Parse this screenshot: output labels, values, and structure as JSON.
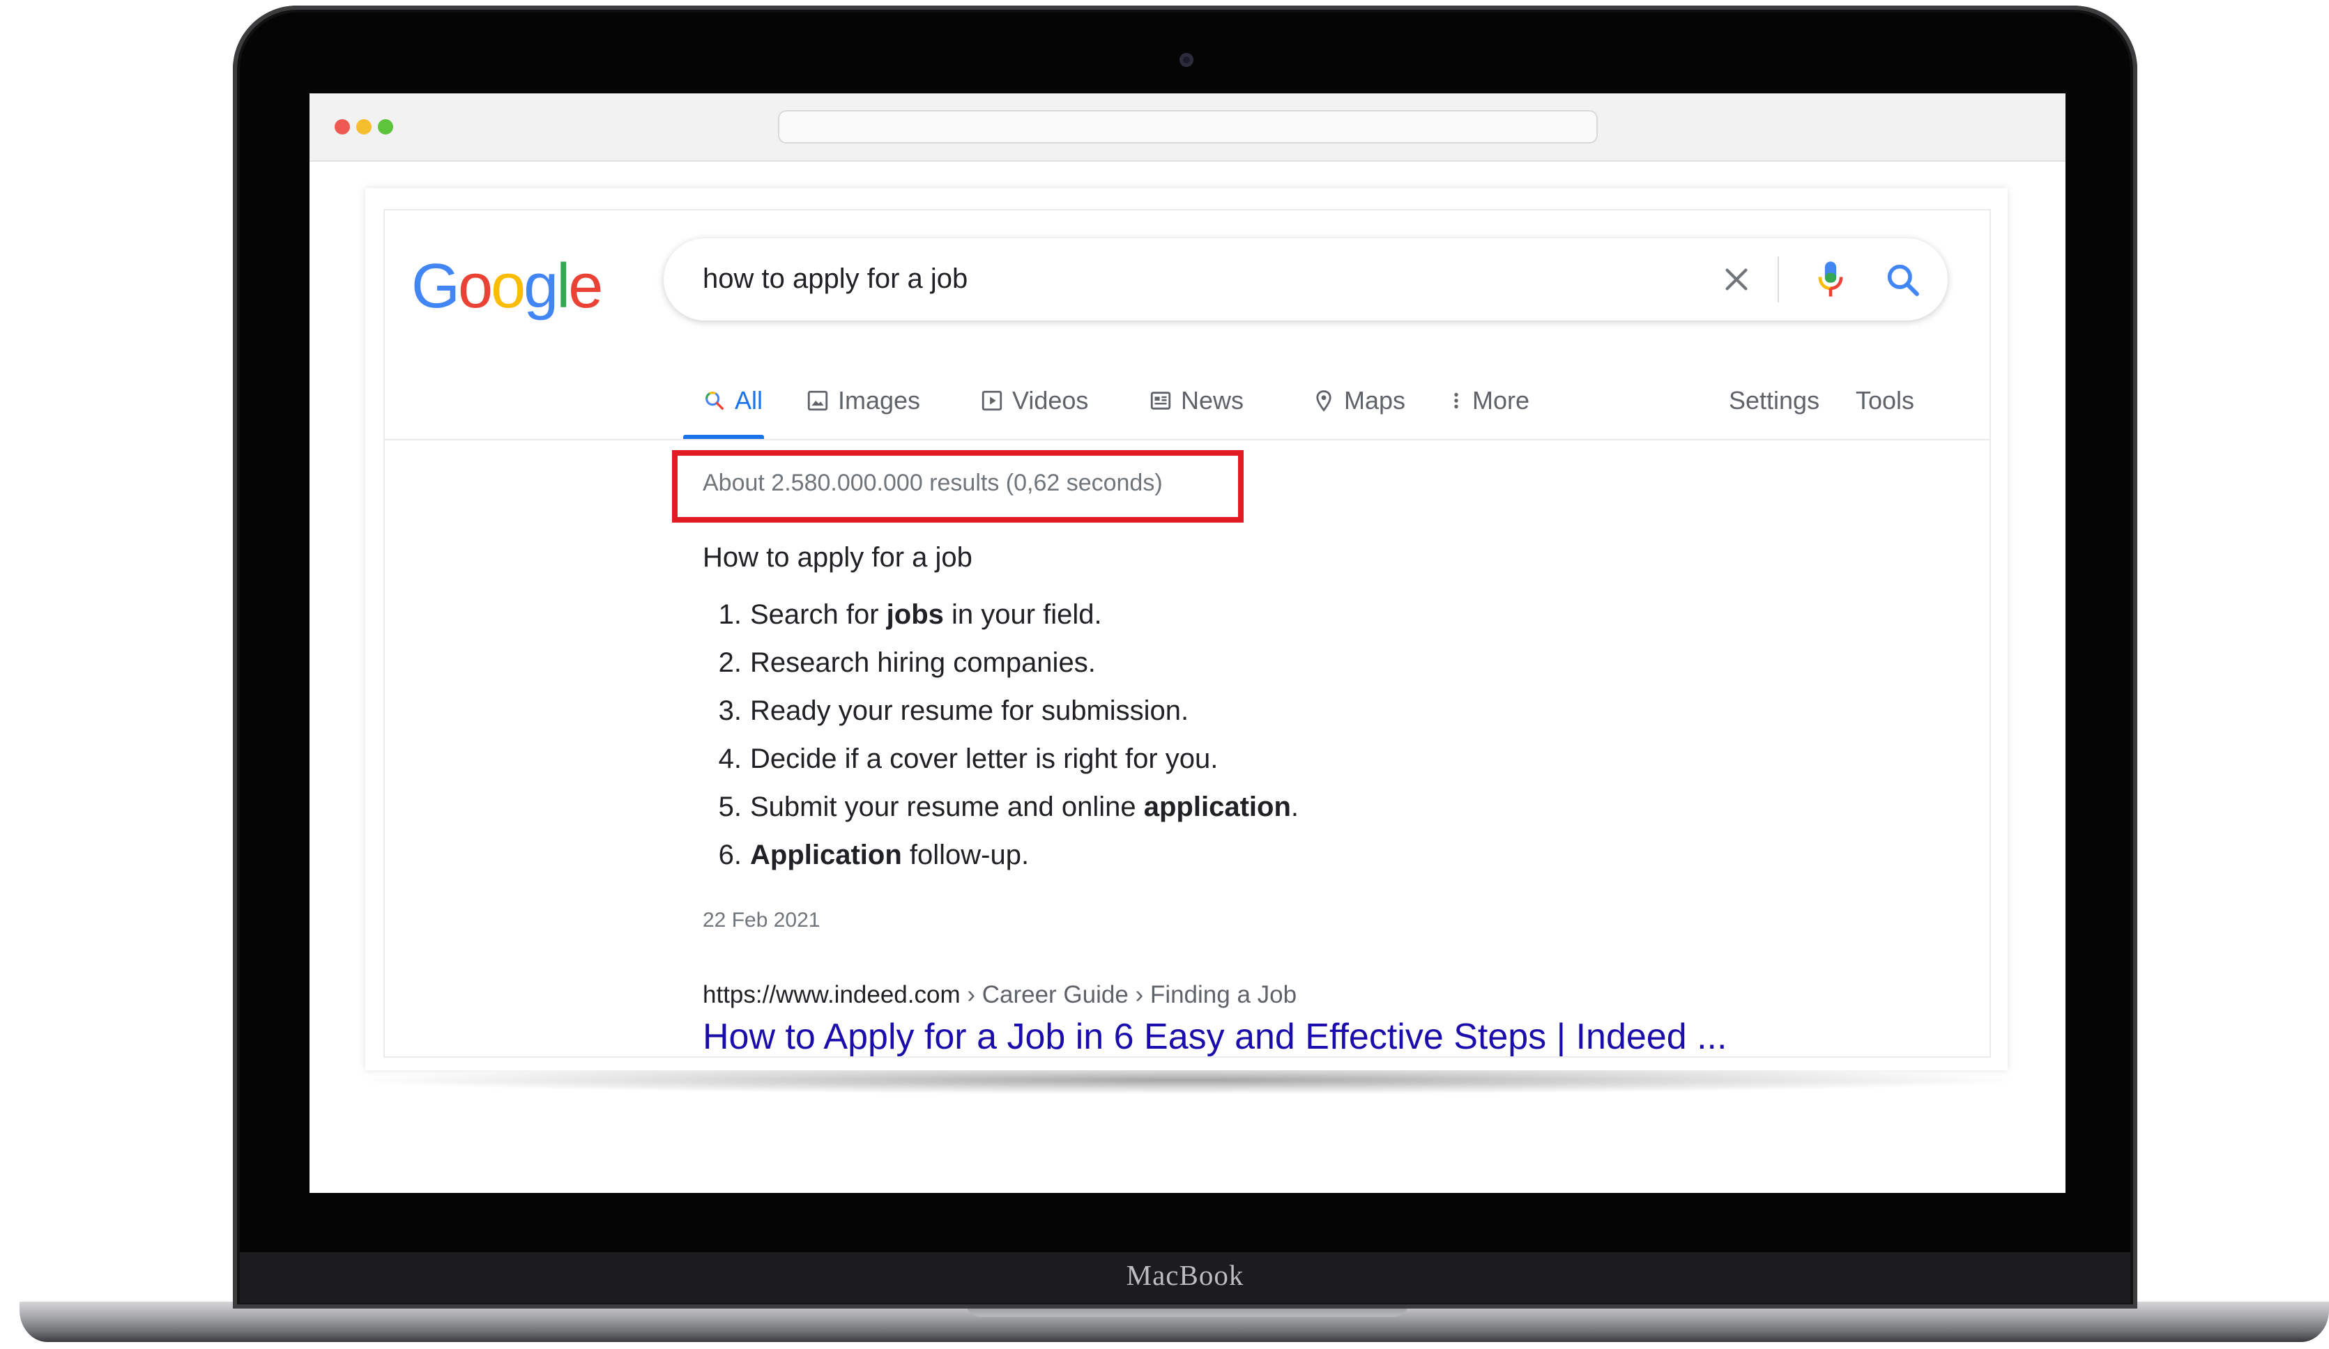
{
  "device": {
    "brand": "MacBook"
  },
  "browser": {
    "address": ""
  },
  "google": {
    "logo": [
      "G",
      "o",
      "o",
      "g",
      "l",
      "e"
    ],
    "logo_colors": [
      "#4285f4",
      "#ea4335",
      "#fbbc05",
      "#4285f4",
      "#34a853",
      "#ea4335"
    ],
    "query": "how to apply for a job",
    "tabs": [
      {
        "label": "All",
        "icon": "search-icon",
        "active": true
      },
      {
        "label": "Images",
        "icon": "image-icon"
      },
      {
        "label": "Videos",
        "icon": "video-icon"
      },
      {
        "label": "News",
        "icon": "news-icon"
      },
      {
        "label": "Maps",
        "icon": "map-pin-icon"
      },
      {
        "label": "More",
        "icon": "more-vertical-icon"
      }
    ],
    "tools": {
      "settings": "Settings",
      "tools": "Tools"
    },
    "stats": "About 2.580.000.000 results (0,62 seconds)",
    "highlight_color": "#e31b23",
    "snippet": {
      "title": "How to apply for a job",
      "steps": [
        {
          "num": "1.",
          "before": "Search for ",
          "bold": "jobs",
          "after": " in your field."
        },
        {
          "num": "2.",
          "before": "Research hiring companies.",
          "bold": "",
          "after": ""
        },
        {
          "num": "3.",
          "before": "Ready your resume for submission.",
          "bold": "",
          "after": ""
        },
        {
          "num": "4.",
          "before": "Decide if a cover letter is right for you.",
          "bold": "",
          "after": ""
        },
        {
          "num": "5.",
          "before": "Submit your resume and online ",
          "bold": "application",
          "after": "."
        },
        {
          "num": "6.",
          "before": "",
          "bold": "Application",
          "after": " follow-up."
        }
      ],
      "date": "22 Feb 2021"
    },
    "result": {
      "url": "https://www.indeed.com",
      "breadcrumb": " › Career Guide › Finding a Job",
      "title": "How to Apply for a Job in 6 Easy and Effective Steps | Indeed ..."
    }
  }
}
